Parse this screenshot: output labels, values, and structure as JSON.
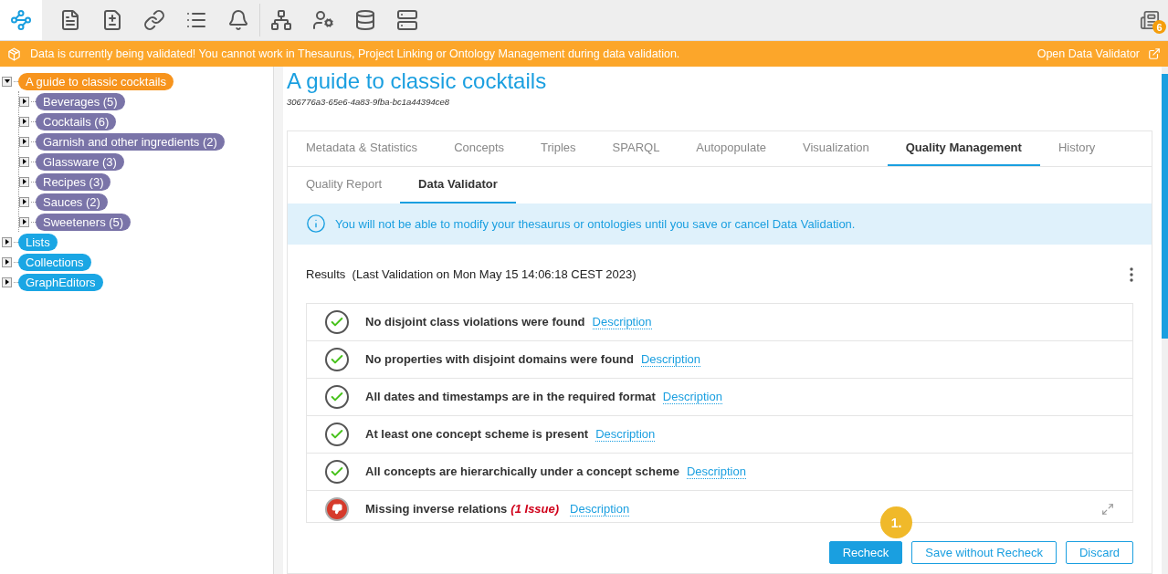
{
  "toolbar": {
    "items": [
      {
        "selected": true
      },
      {
        "selected": false
      },
      {
        "selected": false
      },
      {
        "selected": false
      },
      {
        "selected": false
      },
      {
        "selected": false
      },
      {
        "selected": false
      },
      {
        "selected": false
      },
      {
        "selected": false
      },
      {
        "selected": false
      }
    ],
    "notifications": {
      "count": "6"
    }
  },
  "banner": {
    "message": "Data is currently being validated! You cannot work in Thesaurus, Project Linking or Ontology Management during data validation.",
    "link": "Open Data Validator"
  },
  "tree": [
    {
      "label": "A guide to classic cocktails",
      "kind": "project",
      "expanded": true,
      "children": [
        {
          "label": "Beverages (5)",
          "kind": "scheme",
          "expanded": false
        },
        {
          "label": "Cocktails (6)",
          "kind": "scheme",
          "expanded": false
        },
        {
          "label": "Garnish and other ingredients (2)",
          "kind": "scheme",
          "expanded": false
        },
        {
          "label": "Glassware (3)",
          "kind": "scheme",
          "expanded": false
        },
        {
          "label": "Recipes (3)",
          "kind": "scheme",
          "expanded": false
        },
        {
          "label": "Sauces (2)",
          "kind": "scheme",
          "expanded": false
        },
        {
          "label": "Sweeteners (5)",
          "kind": "scheme",
          "expanded": false
        }
      ]
    },
    {
      "label": "Lists",
      "kind": "folder",
      "expanded": false
    },
    {
      "label": "Collections",
      "kind": "folder",
      "expanded": false
    },
    {
      "label": "GraphEditors",
      "kind": "folder",
      "expanded": false
    }
  ],
  "page": {
    "title": "A guide to classic cocktails",
    "id": "306776a3-65e6-4a83-9fba-bc1a44394ce8"
  },
  "tabs": [
    {
      "label": "Metadata & Statistics",
      "selected": false
    },
    {
      "label": "Concepts",
      "selected": false
    },
    {
      "label": "Triples",
      "selected": false
    },
    {
      "label": "SPARQL",
      "selected": false
    },
    {
      "label": "Autopopulate",
      "selected": false
    },
    {
      "label": "Visualization",
      "selected": false
    },
    {
      "label": "Quality Management",
      "selected": true
    },
    {
      "label": "History",
      "selected": false
    }
  ],
  "subtabs": [
    {
      "label": "Quality Report",
      "selected": false
    },
    {
      "label": "Data Validator",
      "selected": true
    }
  ],
  "info": "You will not be able to modify your thesaurus or ontologies until you save or cancel Data Validation.",
  "results": {
    "title": "Results",
    "last_validation": "(Last Validation on Mon May 15 14:06:18 CEST 2023)",
    "rows": [
      {
        "kind": "passed",
        "text": "No disjoint class violations were found",
        "link": "Description"
      },
      {
        "kind": "passed",
        "text": "No properties with disjoint domains were found",
        "link": "Description"
      },
      {
        "kind": "passed",
        "text": "All dates and timestamps are in the required format",
        "link": "Description"
      },
      {
        "kind": "passed",
        "text": "At least one concept scheme is present",
        "link": "Description"
      },
      {
        "kind": "passed",
        "text": "All concepts are hierarchically under a concept scheme",
        "link": "Description"
      },
      {
        "kind": "failed",
        "text": "Missing inverse relations",
        "issues": "(1 Issue)",
        "link": "Description"
      }
    ]
  },
  "step_badge": "1.",
  "buttons": [
    {
      "label": "Recheck",
      "kind": "primary"
    },
    {
      "label": "Save without Recheck",
      "kind": "secondary"
    },
    {
      "label": "Discard",
      "kind": "secondary"
    }
  ]
}
